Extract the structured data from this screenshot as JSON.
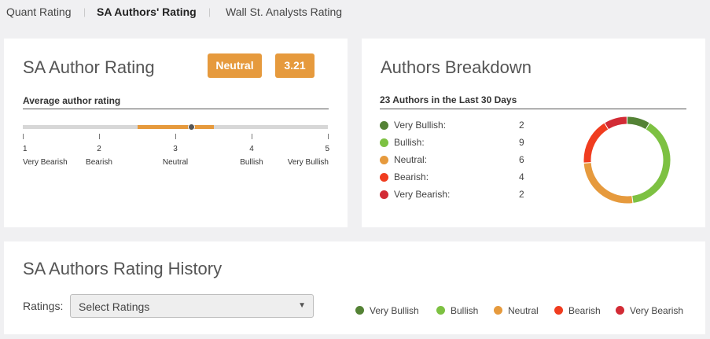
{
  "tabs": [
    {
      "label": "Quant Rating",
      "active": false
    },
    {
      "label": "SA Authors' Rating",
      "active": true
    },
    {
      "label": "Wall St. Analysts Rating",
      "active": false
    }
  ],
  "colors": {
    "very_bullish": "#548235",
    "bullish": "#7dc142",
    "neutral": "#e69a3d",
    "bearish": "#f03c1f",
    "very_bearish": "#d22b35",
    "accent": "#e69a3d"
  },
  "rating_card": {
    "title": "SA Author Rating",
    "badge_label": "Neutral",
    "badge_score": "3.21",
    "subtitle": "Average author rating",
    "value": 3.21,
    "band_range": [
      2.5,
      3.5
    ],
    "scale": [
      {
        "num": "1",
        "label": "Very Bearish"
      },
      {
        "num": "2",
        "label": "Bearish"
      },
      {
        "num": "3",
        "label": "Neutral"
      },
      {
        "num": "4",
        "label": "Bullish"
      },
      {
        "num": "5",
        "label": "Very Bullish"
      }
    ]
  },
  "breakdown_card": {
    "title": "Authors Breakdown",
    "subtitle": "23 Authors in the Last 30 Days",
    "items": [
      {
        "label": "Very Bullish:",
        "count": "2",
        "color": "#548235"
      },
      {
        "label": "Bullish:",
        "count": "9",
        "color": "#7dc142"
      },
      {
        "label": "Neutral:",
        "count": "6",
        "color": "#e69a3d"
      },
      {
        "label": "Bearish:",
        "count": "4",
        "color": "#f03c1f"
      },
      {
        "label": "Very Bearish:",
        "count": "2",
        "color": "#d22b35"
      }
    ]
  },
  "history_card": {
    "title": "SA Authors Rating History",
    "ratings_label": "Ratings:",
    "select_placeholder": "Select Ratings",
    "select_arrow": "▼",
    "legend": [
      {
        "label": "Very Bullish",
        "color": "#548235"
      },
      {
        "label": "Bullish",
        "color": "#7dc142"
      },
      {
        "label": "Neutral",
        "color": "#e69a3d"
      },
      {
        "label": "Bearish",
        "color": "#f03c1f"
      },
      {
        "label": "Very Bearish",
        "color": "#d22b35"
      }
    ]
  }
}
